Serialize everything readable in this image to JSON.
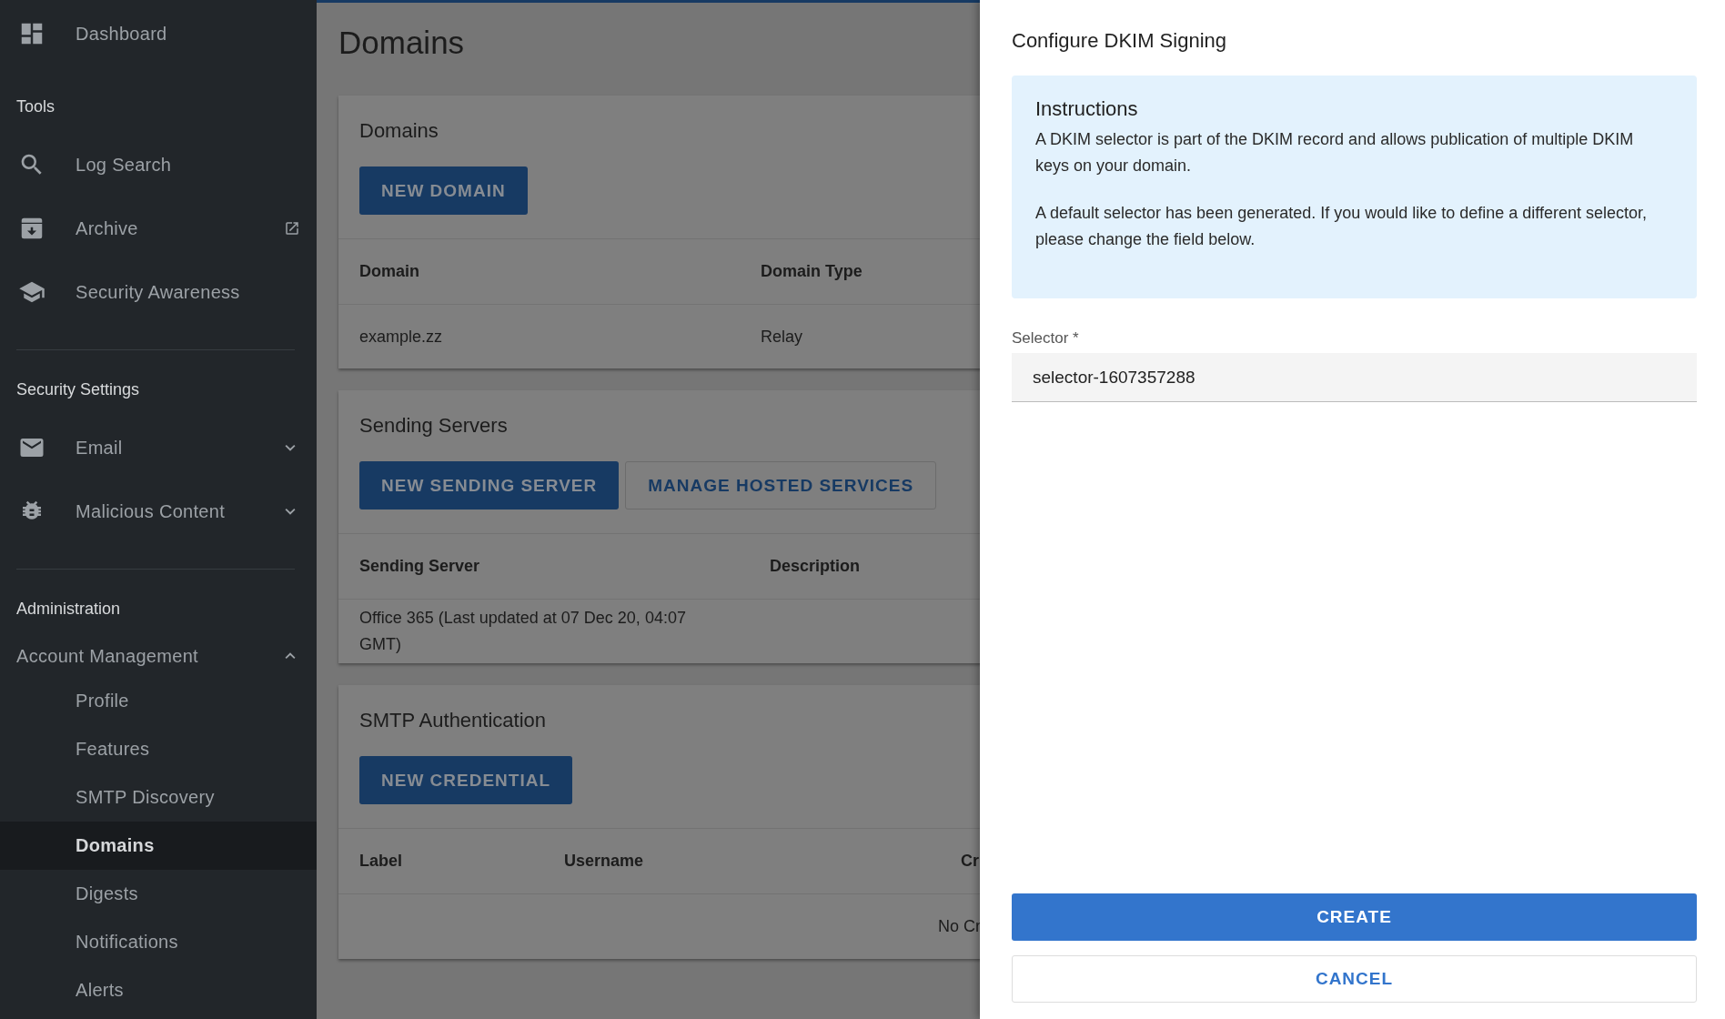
{
  "sidebar": {
    "top_item": {
      "label": "Dashboard",
      "selected": false
    },
    "sections": [
      {
        "title": "Tools",
        "items": [
          {
            "label": "Log Search",
            "selected": false
          },
          {
            "label": "Archive",
            "selected": false,
            "external": true
          },
          {
            "label": "Security Awareness",
            "selected": false
          }
        ]
      },
      {
        "title": "Security Settings",
        "items": [
          {
            "label": "Email",
            "selected": false,
            "expanded": false
          },
          {
            "label": "Malicious Content",
            "selected": false,
            "expanded": false
          }
        ]
      },
      {
        "title": "Administration",
        "items": [
          {
            "label": "Account Management",
            "selected": false,
            "expanded": true,
            "children": [
              {
                "label": "Profile",
                "selected": false
              },
              {
                "label": "Features",
                "selected": false
              },
              {
                "label": "SMTP Discovery",
                "selected": false
              },
              {
                "label": "Domains",
                "selected": true
              },
              {
                "label": "Digests",
                "selected": false
              },
              {
                "label": "Notifications",
                "selected": false
              },
              {
                "label": "Alerts",
                "selected": false
              }
            ]
          }
        ]
      }
    ]
  },
  "main": {
    "page_title": "Domains",
    "cards": [
      {
        "title": "Domains",
        "buttons": [
          {
            "label": "NEW DOMAIN",
            "kind": "primary"
          }
        ],
        "table": {
          "columns": [
            "Domain",
            "Domain Type"
          ],
          "rows": [
            [
              "example.zz",
              "Relay"
            ]
          ]
        }
      },
      {
        "title": "Sending Servers",
        "buttons": [
          {
            "label": "NEW SENDING SERVER",
            "kind": "primary"
          },
          {
            "label": "MANAGE HOSTED SERVICES",
            "kind": "outlined"
          }
        ],
        "table": {
          "columns": [
            "Sending Server",
            "Description"
          ],
          "rows": [
            [
              "Office 365 (Last updated at 07 Dec 20, 04:07 GMT)",
              ""
            ]
          ]
        }
      },
      {
        "title": "SMTP Authentication",
        "buttons": [
          {
            "label": "NEW CREDENTIAL",
            "kind": "primary"
          }
        ],
        "table": {
          "columns": [
            "Label",
            "Username",
            "Cr"
          ],
          "empty_text": "No Cr"
        }
      }
    ]
  },
  "drawer": {
    "title": "Configure DKIM Signing",
    "instructions": {
      "title": "Instructions",
      "paragraphs": [
        "A DKIM selector is part of the DKIM record and allows publication of multiple DKIM keys on your domain.",
        "A default selector has been generated. If you would like to define a different selector, please change the field below."
      ]
    },
    "selector": {
      "label": "Selector *",
      "value": "selector-1607357288"
    },
    "buttons": [
      {
        "label": "CREATE",
        "kind": "primary"
      },
      {
        "label": "CANCEL",
        "kind": "outlined"
      }
    ]
  }
}
